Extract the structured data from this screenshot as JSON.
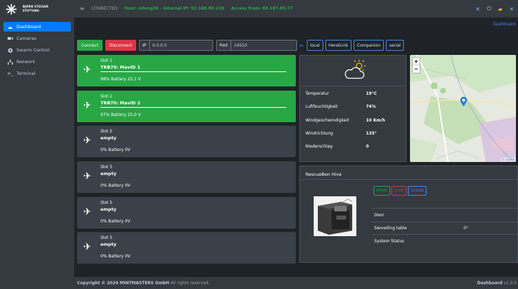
{
  "brand": {
    "line1": "BJÖRN STEIGER",
    "line2": "STIFTUNG"
  },
  "sidebar": {
    "items": [
      {
        "label": "Dashboard",
        "icon": "dashboard-icon",
        "active": true
      },
      {
        "label": "Cameras",
        "icon": "camera-icon",
        "active": false
      },
      {
        "label": "Swarm Control",
        "icon": "swarm-icon",
        "active": false
      },
      {
        "label": "Network",
        "icon": "network-icon",
        "active": false
      },
      {
        "label": "Terminal",
        "icon": "terminal-icon",
        "active": false
      }
    ]
  },
  "topbar": {
    "status": "CONNECTED",
    "host": "Host: mfong36 - Internal IP: 92.168.80.216",
    "access": "Access from: 80.187.85.77"
  },
  "breadcrumb": "Dashboard",
  "connection": {
    "connect_label": "Connect",
    "disconnect_label": "Disconnect",
    "ip_label": "IP",
    "ip_value": "0.0.0.0",
    "port_label": "Port",
    "port_value": "14550",
    "types": [
      "local",
      "HerelLink",
      "Companion",
      "serial"
    ]
  },
  "slots": [
    {
      "title": "Slot 1",
      "name": "TRB70: MavID 1",
      "battery": "98% Battery 25,1 V",
      "connected": true
    },
    {
      "title": "Slot 2",
      "name": "TRB70: MavID 2",
      "battery": "97% Battery 25,0 V",
      "connected": true
    },
    {
      "title": "Slot 5",
      "name": "empty",
      "battery": "0% Battery 0V",
      "connected": false
    },
    {
      "title": "Slot 5",
      "name": "empty",
      "battery": "0% Battery 0V",
      "connected": false
    },
    {
      "title": "Slot 5",
      "name": "empty",
      "battery": "0% Battery 0V",
      "connected": false
    },
    {
      "title": "Slot 5",
      "name": "empty",
      "battery": "0% Battery 0V",
      "connected": false
    }
  ],
  "weather": {
    "rows": [
      {
        "label": "Temperatur",
        "value": "19°C"
      },
      {
        "label": "Luftfeuchtigkeit",
        "value": "74%"
      },
      {
        "label": "Windgeschwindigkeit",
        "value": "10 Km/h"
      },
      {
        "label": "Windrichtung",
        "value": "135°"
      },
      {
        "label": "Niederschlag",
        "value": "0"
      }
    ]
  },
  "map": {
    "zoom_in": "+",
    "zoom_out": "−",
    "attribution": "© Leaflet"
  },
  "hive": {
    "title": "RescueBen Hive",
    "open_label": "OPEN",
    "stop_label": "STOP",
    "close_label": "CLOSE",
    "rows": [
      {
        "label": "Door",
        "value": ""
      },
      {
        "label": "Swivelling table",
        "value": "0°"
      },
      {
        "label": "System Status",
        "value": ""
      }
    ]
  },
  "footer": {
    "copyright_prefix": "Copyright © 2024",
    "company": "MINTMASTERS GmbH",
    "suffix": "All rights reserved.",
    "app": "Dashboard",
    "version": "v1.0.5"
  },
  "colors": {
    "accent": "#007bff",
    "success": "#28a745",
    "danger": "#dc3545",
    "bg": "#1f2327",
    "panel": "#343a40"
  }
}
